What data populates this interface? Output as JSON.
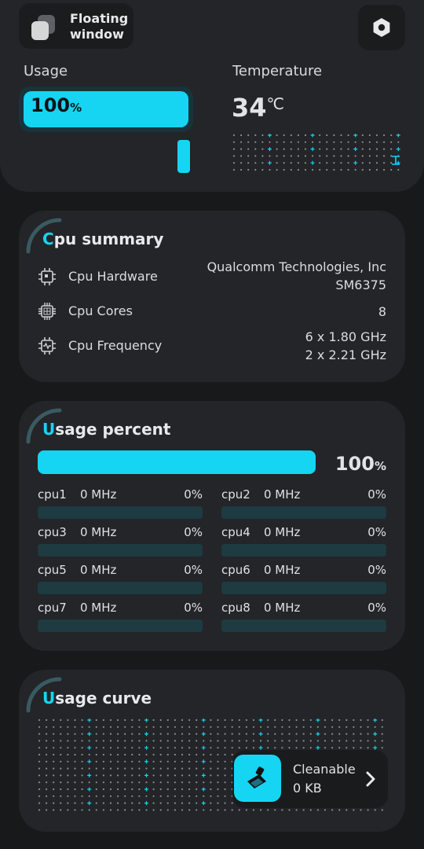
{
  "floating_window": {
    "label": "Floating window"
  },
  "usage": {
    "title": "Usage",
    "value": "100",
    "unit": "%",
    "fraction": 1.0
  },
  "temperature": {
    "title": "Temperature",
    "value": "34",
    "unit": "℃"
  },
  "cpu_summary": {
    "title_first": "C",
    "title_rest": "pu summary",
    "rows": [
      {
        "icon": "chip-icon",
        "label": "Cpu Hardware",
        "value_lines": [
          "Qualcomm Technologies, Inc",
          "SM6375"
        ]
      },
      {
        "icon": "cores-icon",
        "label": "Cpu Cores",
        "value_lines": [
          "8"
        ]
      },
      {
        "icon": "frequency-icon",
        "label": "Cpu Frequency",
        "value_lines": [
          "6 x 1.80 GHz",
          "2 x 2.21 GHz"
        ]
      }
    ]
  },
  "usage_percent": {
    "title_first": "U",
    "title_rest": "sage percent",
    "total_value": "100",
    "total_unit": "%",
    "total_fraction": 1.0,
    "cores": [
      {
        "name": "cpu1",
        "freq": "0 MHz",
        "percent": "0%",
        "fraction": 0
      },
      {
        "name": "cpu2",
        "freq": "0 MHz",
        "percent": "0%",
        "fraction": 0
      },
      {
        "name": "cpu3",
        "freq": "0 MHz",
        "percent": "0%",
        "fraction": 0
      },
      {
        "name": "cpu4",
        "freq": "0 MHz",
        "percent": "0%",
        "fraction": 0
      },
      {
        "name": "cpu5",
        "freq": "0 MHz",
        "percent": "0%",
        "fraction": 0
      },
      {
        "name": "cpu6",
        "freq": "0 MHz",
        "percent": "0%",
        "fraction": 0
      },
      {
        "name": "cpu7",
        "freq": "0 MHz",
        "percent": "0%",
        "fraction": 0
      },
      {
        "name": "cpu8",
        "freq": "0 MHz",
        "percent": "0%",
        "fraction": 0
      }
    ]
  },
  "usage_curve": {
    "title_first": "U",
    "title_rest": "sage curve"
  },
  "cleanable": {
    "label": "Cleanable",
    "size": "0 KB"
  },
  "colors": {
    "accent": "#15d5f3",
    "background": "#18191b",
    "card": "#232528",
    "track": "#1d3b41"
  },
  "icons": {
    "settings": "hexagon-gear-icon",
    "floating": "overlapping-squares-icon",
    "cleaner": "broom-icon",
    "chevron": "chevron-right-icon"
  }
}
